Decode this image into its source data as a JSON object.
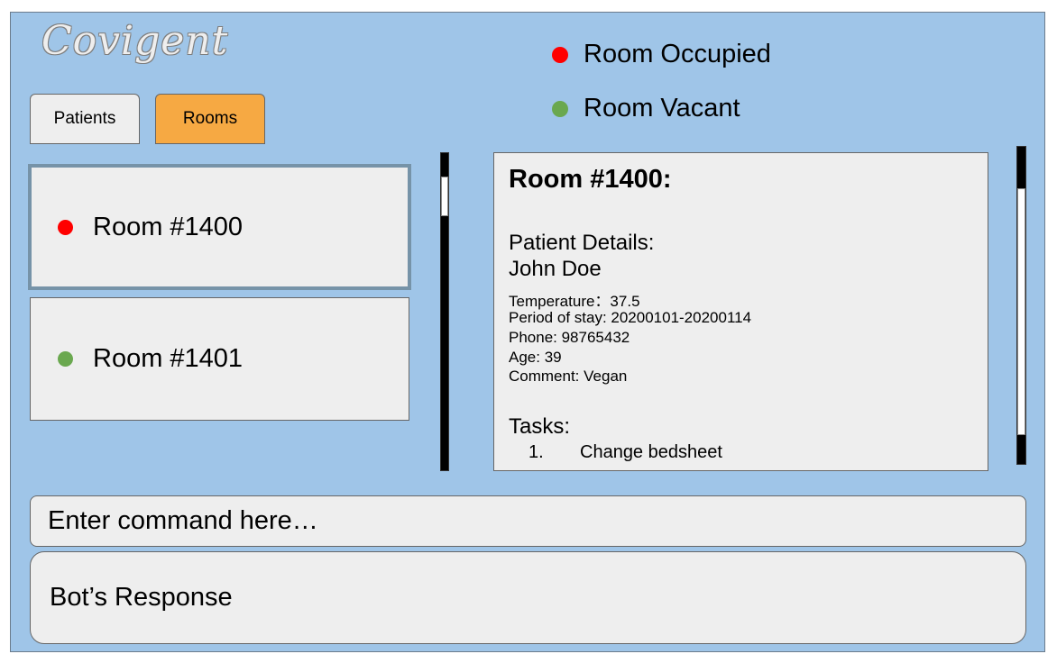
{
  "app": {
    "logo_text": "Covigent"
  },
  "tabs": [
    {
      "label": "Patients",
      "active": false,
      "color": "#eeeeee"
    },
    {
      "label": "Rooms",
      "active": true,
      "color": "#f6a943"
    }
  ],
  "legend": [
    {
      "label": "Room Occupied",
      "color": "#ff0000"
    },
    {
      "label": "Room Vacant",
      "color": "#6aa84f"
    }
  ],
  "rooms": [
    {
      "label": "Room #1400",
      "status_color": "#ff0000",
      "selected": true
    },
    {
      "label": "Room #1401",
      "status_color": "#6aa84f",
      "selected": false
    }
  ],
  "details": {
    "title": "Room #1400:",
    "patient_details_label": "Patient Details:",
    "patient_name": "John Doe",
    "info": [
      "Temperature：37.5",
      "Period of stay: 20200101-20200114",
      "Phone: 98765432",
      "Age: 39",
      "Comment: Vegan"
    ],
    "tasks_label": "Tasks:",
    "tasks": [
      {
        "number": "1.",
        "text": "Change bedsheet"
      }
    ]
  },
  "command": {
    "placeholder": "Enter command here…"
  },
  "bot": {
    "response": "Bot’s Response"
  }
}
